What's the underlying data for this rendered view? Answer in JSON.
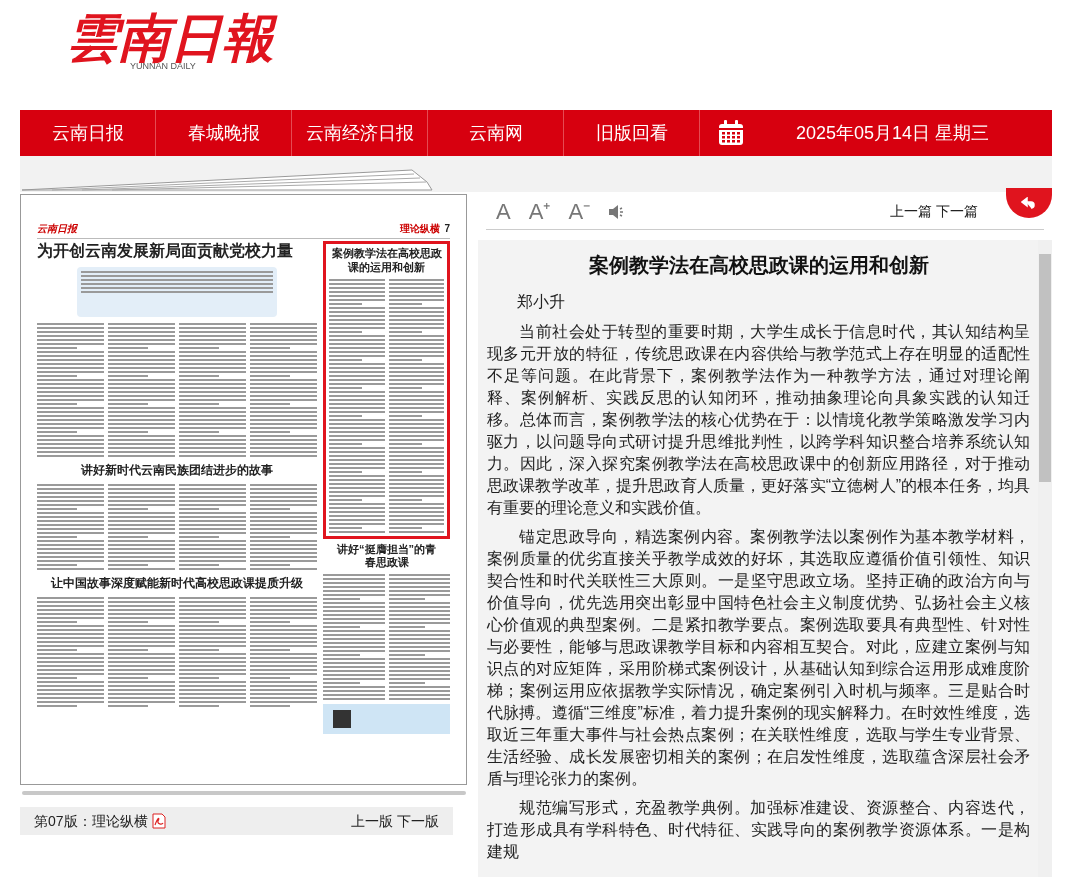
{
  "logo": {
    "title": "雲南日報",
    "subtitle": "YUNNAN DAILY"
  },
  "nav": [
    {
      "label": "云南日报",
      "kind": "link"
    },
    {
      "label": "春城晚报",
      "kind": "link"
    },
    {
      "label": "云南经济日报",
      "kind": "link"
    },
    {
      "label": "云南网",
      "kind": "link"
    },
    {
      "label": "旧版回看",
      "kind": "link"
    },
    {
      "kind": "calendar"
    },
    {
      "label": "2025年05月14日 星期三",
      "kind": "date"
    }
  ],
  "page_image": {
    "masthead": "云南日报",
    "section": "理论纵横",
    "page_number": "7",
    "headlines": [
      {
        "text": "为开创云南发展新局面贡献党校力量",
        "kind": "top"
      },
      {
        "text": "案例教学法在高校思政课的运用和创新",
        "kind": "selected"
      },
      {
        "text": "讲好新时代云南民族团结进步的故事",
        "kind": "middle"
      },
      {
        "text": "讲好“挺膺担当”的青春思政课",
        "kind": "side"
      },
      {
        "text": "让中国故事深度赋能新时代高校思政课提质升级",
        "kind": "bottom"
      }
    ]
  },
  "page_bar": {
    "label": "第07版：理论纵横",
    "prev": "上一版",
    "next": "下一版"
  },
  "toolbar": {
    "font_buttons": [
      "A",
      "A⁺",
      "A⁻"
    ],
    "prev": "上一篇",
    "next": "下一篇"
  },
  "article": {
    "title": "案例教学法在高校思政课的运用和创新",
    "author": "郑小升",
    "paragraphs": [
      "当前社会处于转型的重要时期，大学生成长于信息时代，其认知结构呈现多元开放的特征，传统思政课在内容供给与教学范式上存在明显的适配性不足等问题。在此背景下，案例教学法作为一种教学方法，通过对理论阐释、案例解析、实践反思的认知闭环，推动抽象理论向具象实践的认知迁移。总体而言，案例教学法的核心优势在于：以情境化教学策略激发学习内驱力，以问题导向式研讨提升思维批判性，以跨学科知识整合培养系统认知力。因此，深入探究案例教学法在高校思政课中的创新应用路径，对于推动思政课教学改革，提升思政育人质量，更好落实“立德树人”的根本任务，均具有重要的理论意义和实践价值。",
      "锚定思政导向，精选案例内容。案例教学法以案例作为基本教学材料，案例质量的优劣直接关乎教学成效的好坏，其选取应遵循价值引领性、知识契合性和时代关联性三大原则。一是坚守思政立场。坚持正确的政治方向与价值导向，优先选用突出彰显中国特色社会主义制度优势、弘扬社会主义核心价值观的典型案例。二是紧扣教学要点。案例选取要具有典型性、针对性与必要性，能够与思政课教学目标和内容相互契合。对此，应建立案例与知识点的对应矩阵，采用阶梯式案例设计，从基础认知到综合运用形成难度阶梯；案例运用应依据教学实际情况，确定案例引入时机与频率。三是贴合时代脉搏。遵循“三维度”标准，着力提升案例的现实解释力。在时效性维度，选取近三年重大事件与社会热点案例；在关联性维度，选取与学生专业背景、生活经验、成长发展密切相关的案例；在启发性维度，选取蕴含深层社会矛盾与理论张力的案例。",
      "规范编写形式，充盈教学典例。加强标准建设、资源整合、内容迭代，打造形成具有学科特色、时代特征、实践导向的案例教学资源体系。一是构建规"
    ]
  }
}
